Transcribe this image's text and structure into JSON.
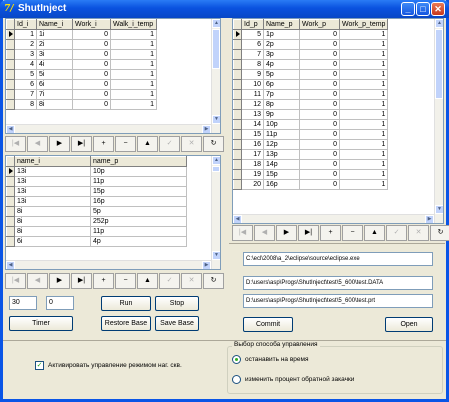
{
  "window": {
    "title": "ShutInject",
    "icon_letter": "7/"
  },
  "grid_i": {
    "headers": [
      "Id_i",
      "Name_i",
      "Work_i",
      "Walk_i_temp"
    ],
    "rows": [
      [
        "1",
        "1i",
        "0",
        "1"
      ],
      [
        "2",
        "2i",
        "0",
        "1"
      ],
      [
        "3",
        "3i",
        "0",
        "1"
      ],
      [
        "4",
        "4i",
        "0",
        "1"
      ],
      [
        "5",
        "5i",
        "0",
        "1"
      ],
      [
        "6",
        "6i",
        "0",
        "1"
      ],
      [
        "7",
        "7i",
        "0",
        "1"
      ],
      [
        "8",
        "8i",
        "0",
        "1"
      ]
    ]
  },
  "grid_link": {
    "headers": [
      "name_i",
      "name_p"
    ],
    "rows": [
      [
        "13i",
        "10p"
      ],
      [
        "13i",
        "11p"
      ],
      [
        "13i",
        "15p"
      ],
      [
        "13i",
        "16p"
      ],
      [
        "8i",
        "5p"
      ],
      [
        "8i",
        "252p"
      ],
      [
        "8i",
        "11p"
      ],
      [
        "6i",
        "4p"
      ]
    ]
  },
  "grid_p": {
    "headers": [
      "Id_p",
      "Name_p",
      "Work_p",
      "Work_p_temp"
    ],
    "rows": [
      [
        "5",
        "1p",
        "0",
        "1"
      ],
      [
        "6",
        "2p",
        "0",
        "1"
      ],
      [
        "7",
        "3p",
        "0",
        "1"
      ],
      [
        "8",
        "4p",
        "0",
        "1"
      ],
      [
        "9",
        "5p",
        "0",
        "1"
      ],
      [
        "10",
        "6p",
        "0",
        "1"
      ],
      [
        "11",
        "7p",
        "0",
        "1"
      ],
      [
        "12",
        "8p",
        "0",
        "1"
      ],
      [
        "13",
        "9p",
        "0",
        "1"
      ],
      [
        "14",
        "10p",
        "0",
        "1"
      ],
      [
        "15",
        "11p",
        "0",
        "1"
      ],
      [
        "16",
        "12p",
        "0",
        "1"
      ],
      [
        "17",
        "13p",
        "0",
        "1"
      ],
      [
        "18",
        "14p",
        "0",
        "1"
      ],
      [
        "19",
        "15p",
        "0",
        "1"
      ],
      [
        "20",
        "16p",
        "0",
        "1"
      ]
    ]
  },
  "navigator": [
    "|◀",
    "◀",
    "▶",
    "▶|",
    "+",
    "−",
    "▲",
    "✓",
    "✕",
    "↻"
  ],
  "controls": {
    "timer_value1": "30",
    "timer_value2": "0",
    "timer_button": "Timer",
    "run_button": "Run",
    "stop_button": "Stop",
    "restore_button": "Restore Base",
    "save_button": "Save Base",
    "commit_button": "Commit",
    "open_button": "Open",
    "path1": "C:\\ecl\\2008\\a_2\\eclipse\\source\\eclipse.exe",
    "path2": "D:\\users\\asp\\Progs\\ShutInject\\test\\5_600\\test.DATA",
    "path3": "D:\\users\\asp\\Progs\\ShutInject\\test\\5_600\\test.prt"
  },
  "bottom": {
    "checkbox_label": "Активировать управление режимом наг. скв.",
    "group_title": "Выбор способа управления",
    "radio1": "останавить на время",
    "radio2": "изменить процент обратной закачки"
  }
}
